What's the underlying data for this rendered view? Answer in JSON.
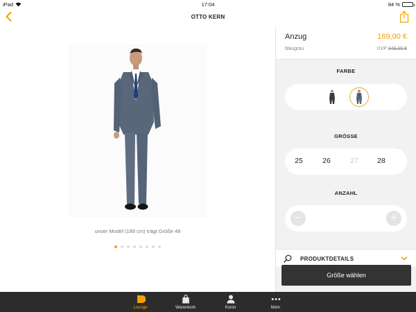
{
  "status_bar": {
    "device": "iPad",
    "time": "17:04",
    "battery": "84 %",
    "battery_level": 0.84
  },
  "nav": {
    "title": "OTTO KERN"
  },
  "product": {
    "name": "Anzug",
    "price": "169,00 €",
    "color_name": "blaugrau",
    "uvp_label": "UVP",
    "uvp_price": "349,00 €",
    "image_caption": "unser Model (189 cm) trägt Größe 48",
    "gallery_count": 8,
    "gallery_active_index": 0
  },
  "sections": {
    "color_title": "FARBE",
    "size_title": "GRÖSSE",
    "quantity_title": "ANZAHL",
    "details_label": "PRODUKTDETAILS"
  },
  "sizes": [
    {
      "label": "25",
      "available": true
    },
    {
      "label": "26",
      "available": true
    },
    {
      "label": "27",
      "available": false
    },
    {
      "label": "28",
      "available": true
    }
  ],
  "quantity": {
    "minus": "−",
    "plus": "+"
  },
  "cta_label": "Größe wählen",
  "colors": {
    "accent": "#f2a100",
    "dark": "#333333",
    "tabbar": "#2c2c2c"
  },
  "tabs": [
    {
      "label": "Lounge",
      "icon": "lounge-play-icon",
      "active": true
    },
    {
      "label": "Warenkorb",
      "icon": "shopping-bag-icon",
      "active": false
    },
    {
      "label": "Konto",
      "icon": "person-icon",
      "active": false
    },
    {
      "label": "Mehr",
      "icon": "more-dots-icon",
      "active": false
    }
  ]
}
